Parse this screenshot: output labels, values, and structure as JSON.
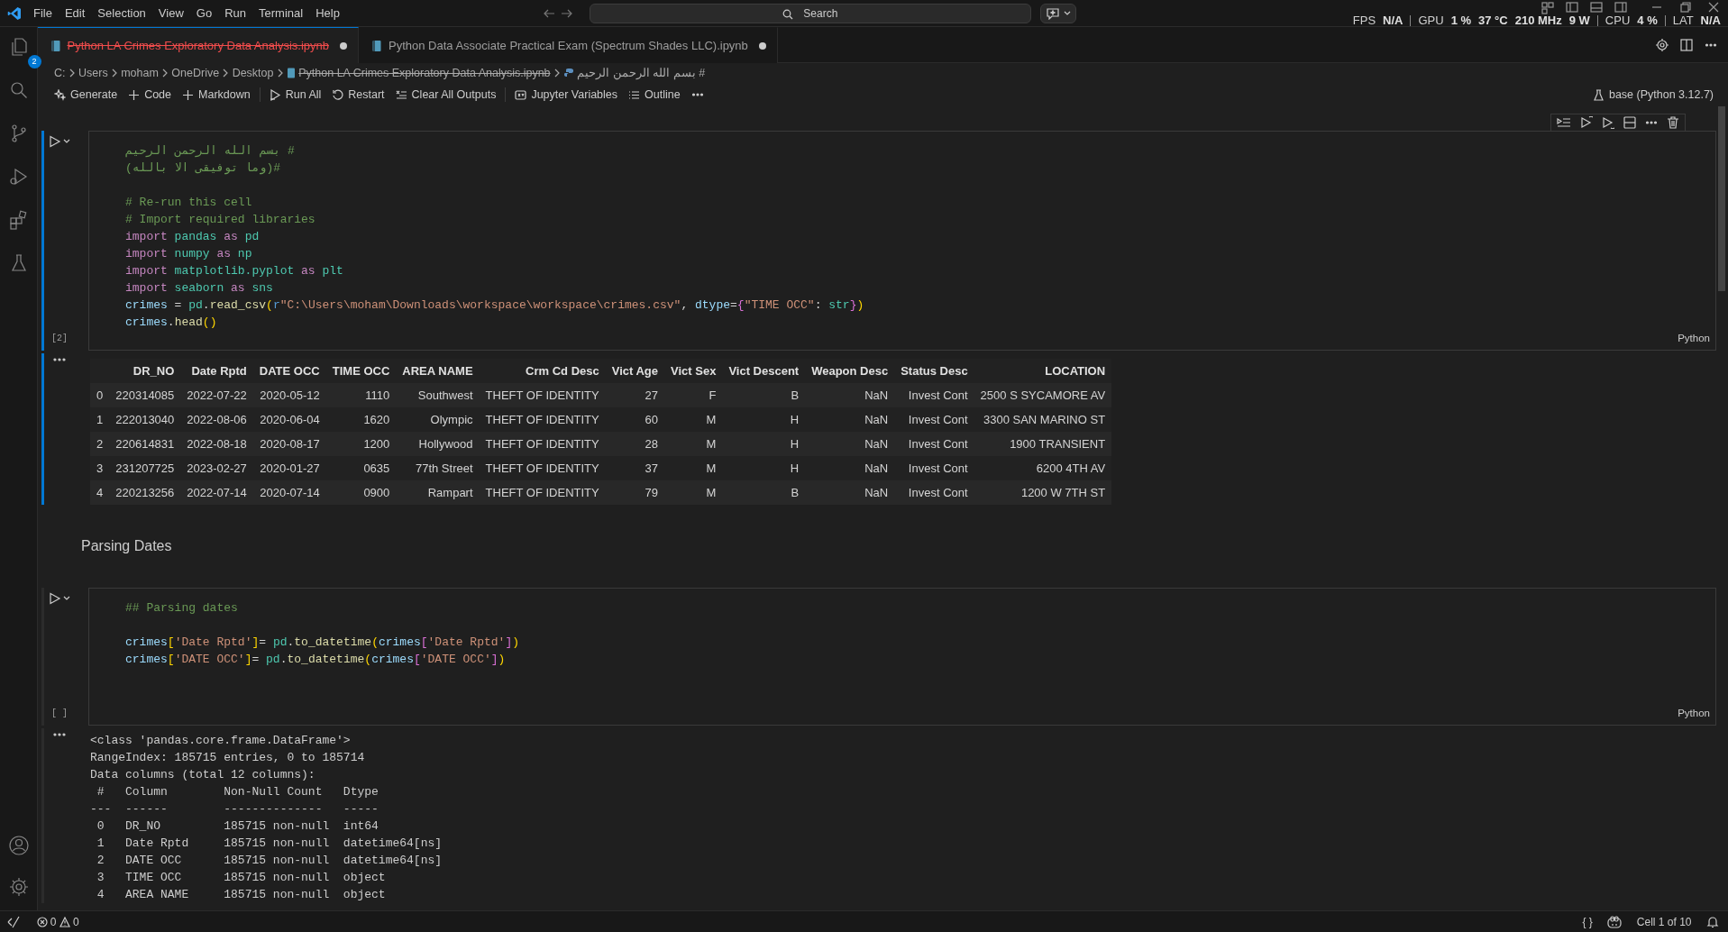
{
  "menu_bar": {
    "items": [
      "File",
      "Edit",
      "Selection",
      "View",
      "Go",
      "Run",
      "Terminal",
      "Help"
    ],
    "search": {
      "placeholder": "Search"
    }
  },
  "perf_overlay": [
    {
      "label": "FPS",
      "values": [
        "N/A"
      ]
    },
    {
      "label": "GPU",
      "values": [
        "1 %",
        "37 °C",
        "210 MHz",
        "9 W"
      ]
    },
    {
      "label": "CPU",
      "values": [
        "4 %"
      ]
    },
    {
      "label": "LAT",
      "values": [
        "N/A"
      ]
    }
  ],
  "activity_bar": {
    "explorer_badge": "2"
  },
  "tabs": [
    {
      "label": "Python LA Crimes Exploratory Data Analysis.ipynb",
      "selected": true,
      "deleted": true,
      "modified": true
    },
    {
      "label": "Python Data Associate Practical Exam (Spectrum Shades LLC).ipynb",
      "selected": false,
      "deleted": false,
      "modified": true
    }
  ],
  "breadcrumb": [
    {
      "label": "C:",
      "deleted": false
    },
    {
      "label": "Users",
      "deleted": false
    },
    {
      "label": "moham",
      "deleted": false
    },
    {
      "label": "OneDrive",
      "deleted": false
    },
    {
      "label": "Desktop",
      "deleted": false
    },
    {
      "label": "Python LA Crimes Exploratory Data Analysis.ipynb",
      "deleted": true
    },
    {
      "label": "# بسم الله الرحمن الرحيم",
      "deleted": false
    }
  ],
  "toolbar": {
    "groups": [
      [
        "Generate",
        "Code",
        "Markdown"
      ],
      [
        "Run All",
        "Restart",
        "Clear All Outputs"
      ],
      [
        "Jupyter Variables",
        "Outline"
      ]
    ],
    "kernel": "base (Python 3.12.7)"
  },
  "cells": [
    {
      "kind": "code",
      "selected": true,
      "execution_count": "[2]",
      "language": "Python",
      "lines": [
        {
          "kind": "code",
          "tokens": [
            {
              "text": "# بسم الله الرحمن الرحيم",
              "kind": "comment"
            }
          ]
        },
        {
          "kind": "code",
          "tokens": [
            {
              "text": "#(وما توفيقى الا بالله)",
              "kind": "comment"
            }
          ]
        },
        {
          "kind": "blank"
        },
        {
          "kind": "code",
          "tokens": [
            {
              "text": "# Re-run this cell",
              "kind": "comment"
            }
          ]
        },
        {
          "kind": "code",
          "tokens": [
            {
              "text": "# Import required libraries",
              "kind": "comment"
            }
          ]
        },
        {
          "kind": "code",
          "tokens": [
            {
              "text": "import ",
              "kind": "keyword"
            },
            {
              "text": "pandas ",
              "kind": "module"
            },
            {
              "text": "as ",
              "kind": "keyword"
            },
            {
              "text": "pd",
              "kind": "module"
            }
          ]
        },
        {
          "kind": "code",
          "tokens": [
            {
              "text": "import ",
              "kind": "keyword"
            },
            {
              "text": "numpy ",
              "kind": "module"
            },
            {
              "text": "as ",
              "kind": "keyword"
            },
            {
              "text": "np",
              "kind": "module"
            }
          ]
        },
        {
          "kind": "code",
          "tokens": [
            {
              "text": "import ",
              "kind": "keyword"
            },
            {
              "text": "matplotlib.pyplot ",
              "kind": "module"
            },
            {
              "text": "as ",
              "kind": "keyword"
            },
            {
              "text": "plt",
              "kind": "module"
            }
          ]
        },
        {
          "kind": "code",
          "tokens": [
            {
              "text": "import ",
              "kind": "keyword"
            },
            {
              "text": "seaborn ",
              "kind": "module"
            },
            {
              "text": "as ",
              "kind": "keyword"
            },
            {
              "text": "sns",
              "kind": "module"
            }
          ]
        },
        {
          "kind": "code",
          "tokens": [
            {
              "text": "crimes",
              "kind": "variable"
            },
            {
              "text": " = ",
              "kind": "plain"
            },
            {
              "text": "pd",
              "kind": "module"
            },
            {
              "text": ".",
              "kind": "plain"
            },
            {
              "text": "read_csv",
              "kind": "function"
            },
            {
              "text": "(",
              "kind": "bracket1"
            },
            {
              "text": "r",
              "kind": "storage"
            },
            {
              "text": "\"C:\\Users\\moham\\Downloads\\workspace\\workspace\\crimes.csv\"",
              "kind": "string"
            },
            {
              "text": ", ",
              "kind": "plain"
            },
            {
              "text": "dtype",
              "kind": "variable"
            },
            {
              "text": "=",
              "kind": "plain"
            },
            {
              "text": "{",
              "kind": "bracket2"
            },
            {
              "text": "\"TIME OCC\"",
              "kind": "string"
            },
            {
              "text": ": ",
              "kind": "plain"
            },
            {
              "text": "str",
              "kind": "module"
            },
            {
              "text": "}",
              "kind": "bracket2"
            },
            {
              "text": ")",
              "kind": "bracket1"
            }
          ]
        },
        {
          "kind": "code",
          "tokens": [
            {
              "text": "crimes",
              "kind": "variable"
            },
            {
              "text": ".",
              "kind": "plain"
            },
            {
              "text": "head",
              "kind": "function"
            },
            {
              "text": "()",
              "kind": "bracket1"
            }
          ]
        }
      ],
      "output": {
        "kind": "table",
        "columns": [
          "",
          "DR_NO",
          "Date Rptd",
          "DATE OCC",
          "TIME OCC",
          "AREA NAME",
          "Crm Cd Desc",
          "Vict Age",
          "Vict Sex",
          "Vict Descent",
          "Weapon Desc",
          "Status Desc",
          "LOCATION"
        ],
        "rows": [
          [
            "0",
            "220314085",
            "2022-07-22",
            "2020-05-12",
            "1110",
            "Southwest",
            "THEFT OF IDENTITY",
            "27",
            "F",
            "B",
            "NaN",
            "Invest Cont",
            "2500 S SYCAMORE AV"
          ],
          [
            "1",
            "222013040",
            "2022-08-06",
            "2020-06-04",
            "1620",
            "Olympic",
            "THEFT OF IDENTITY",
            "60",
            "M",
            "H",
            "NaN",
            "Invest Cont",
            "3300 SAN MARINO ST"
          ],
          [
            "2",
            "220614831",
            "2022-08-18",
            "2020-08-17",
            "1200",
            "Hollywood",
            "THEFT OF IDENTITY",
            "28",
            "M",
            "H",
            "NaN",
            "Invest Cont",
            "1900 TRANSIENT"
          ],
          [
            "3",
            "231207725",
            "2023-02-27",
            "2020-01-27",
            "0635",
            "77th Street",
            "THEFT OF IDENTITY",
            "37",
            "M",
            "H",
            "NaN",
            "Invest Cont",
            "6200 4TH AV"
          ],
          [
            "4",
            "220213256",
            "2022-07-14",
            "2020-07-14",
            "0900",
            "Rampart",
            "THEFT OF IDENTITY",
            "79",
            "M",
            "B",
            "NaN",
            "Invest Cont",
            "1200 W 7TH ST"
          ]
        ]
      }
    },
    {
      "kind": "markdown",
      "text": "Parsing Dates"
    },
    {
      "kind": "code",
      "selected": false,
      "execution_count": "[ ]",
      "language": "Python",
      "lines": [
        {
          "kind": "code",
          "tokens": [
            {
              "text": "## Parsing dates",
              "kind": "comment"
            }
          ]
        },
        {
          "kind": "blank"
        },
        {
          "kind": "code",
          "tokens": [
            {
              "text": "crimes",
              "kind": "variable"
            },
            {
              "text": "[",
              "kind": "bracket1"
            },
            {
              "text": "'Date Rptd'",
              "kind": "string"
            },
            {
              "text": "]",
              "kind": "bracket1"
            },
            {
              "text": "= ",
              "kind": "plain"
            },
            {
              "text": "pd",
              "kind": "module"
            },
            {
              "text": ".",
              "kind": "plain"
            },
            {
              "text": "to_datetime",
              "kind": "function"
            },
            {
              "text": "(",
              "kind": "bracket1"
            },
            {
              "text": "crimes",
              "kind": "variable"
            },
            {
              "text": "[",
              "kind": "bracket2"
            },
            {
              "text": "'Date Rptd'",
              "kind": "string"
            },
            {
              "text": "]",
              "kind": "bracket2"
            },
            {
              "text": ")",
              "kind": "bracket1"
            }
          ]
        },
        {
          "kind": "code",
          "tokens": [
            {
              "text": "crimes",
              "kind": "variable"
            },
            {
              "text": "[",
              "kind": "bracket1"
            },
            {
              "text": "'DATE OCC'",
              "kind": "string"
            },
            {
              "text": "]",
              "kind": "bracket1"
            },
            {
              "text": "= ",
              "kind": "plain"
            },
            {
              "text": "pd",
              "kind": "module"
            },
            {
              "text": ".",
              "kind": "plain"
            },
            {
              "text": "to_datetime",
              "kind": "function"
            },
            {
              "text": "(",
              "kind": "bracket1"
            },
            {
              "text": "crimes",
              "kind": "variable"
            },
            {
              "text": "[",
              "kind": "bracket2"
            },
            {
              "text": "'DATE OCC'",
              "kind": "string"
            },
            {
              "text": "]",
              "kind": "bracket2"
            },
            {
              "text": ")",
              "kind": "bracket1"
            }
          ]
        }
      ],
      "output": {
        "kind": "text",
        "lines": [
          "<class 'pandas.core.frame.DataFrame'>",
          "RangeIndex: 185715 entries, 0 to 185714",
          "Data columns (total 12 columns):",
          " #   Column        Non-Null Count   Dtype",
          "---  ------        --------------   -----",
          " 0   DR_NO         185715 non-null  int64",
          " 1   Date Rptd     185715 non-null  datetime64[ns]",
          " 2   DATE OCC      185715 non-null  datetime64[ns]",
          " 3   TIME OCC      185715 non-null  object",
          " 4   AREA NAME     185715 non-null  object"
        ]
      }
    }
  ],
  "status_bar": {
    "errors": "0",
    "warnings": "0",
    "braces": "{ }",
    "cell_position": "Cell 1 of 10"
  }
}
